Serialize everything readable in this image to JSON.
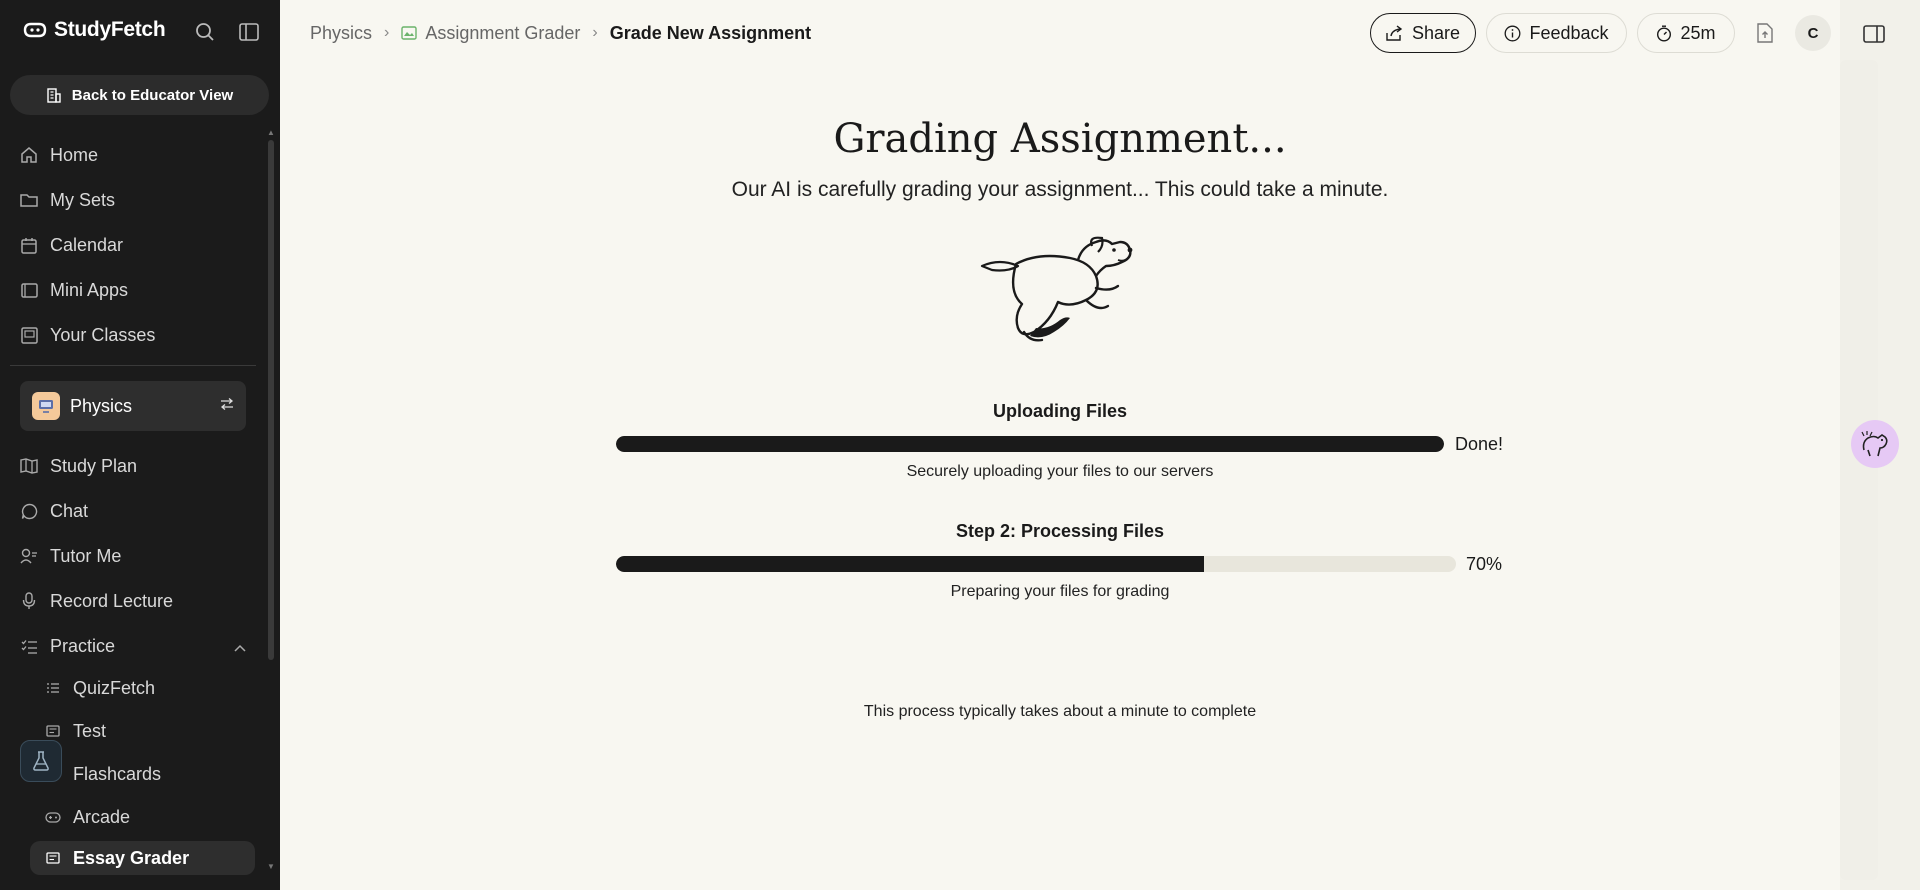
{
  "app": {
    "name": "StudyFetch"
  },
  "sidebar": {
    "back_label": "Back to Educator View",
    "main_items": [
      {
        "label": "Home",
        "icon": "home-icon"
      },
      {
        "label": "My Sets",
        "icon": "folder-icon"
      },
      {
        "label": "Calendar",
        "icon": "calendar-icon"
      },
      {
        "label": "Mini Apps",
        "icon": "app-window-icon"
      },
      {
        "label": "Your Classes",
        "icon": "classes-icon"
      }
    ],
    "class": {
      "name": "Physics"
    },
    "class_items": [
      {
        "label": "Study Plan",
        "icon": "map-icon"
      },
      {
        "label": "Chat",
        "icon": "chat-bubble-icon"
      },
      {
        "label": "Tutor Me",
        "icon": "tutor-icon"
      },
      {
        "label": "Record Lecture",
        "icon": "microphone-icon"
      },
      {
        "label": "Practice",
        "icon": "list-check-icon"
      }
    ],
    "practice_items": [
      {
        "label": "QuizFetch",
        "icon": "quiz-list-icon"
      },
      {
        "label": "Test",
        "icon": "test-icon"
      },
      {
        "label": "Flashcards",
        "icon": "flashcards-icon"
      },
      {
        "label": "Arcade",
        "icon": "gamepad-icon"
      },
      {
        "label": "Essay Grader",
        "icon": "essay-icon",
        "active": true
      }
    ]
  },
  "breadcrumb": {
    "items": [
      "Physics",
      "Assignment Grader"
    ],
    "current": "Grade New Assignment"
  },
  "topbar": {
    "share_label": "Share",
    "feedback_label": "Feedback",
    "timer_label": "25m",
    "avatar_initial": "C"
  },
  "main": {
    "title": "Grading Assignment...",
    "subtitle": "Our AI is carefully grading your assignment... This could take a minute.",
    "steps": [
      {
        "title": "Uploading Files",
        "progress": 1.0,
        "status": "Done!",
        "description": "Securely uploading your files to our servers"
      },
      {
        "title": "Step 2: Processing Files",
        "progress": 0.7,
        "status": "70%",
        "description": "Preparing your files for grading"
      }
    ],
    "footnote": "This process typically takes about a minute to complete"
  },
  "colors": {
    "sidebar_bg": "#1b1b1b",
    "page_bg": "#f8f7f1",
    "bar_fill": "#1a1a1a",
    "bar_track": "#e8e6dc",
    "class_avatar": "#f4c99a",
    "mascot_bg": "#e6c9f5"
  }
}
